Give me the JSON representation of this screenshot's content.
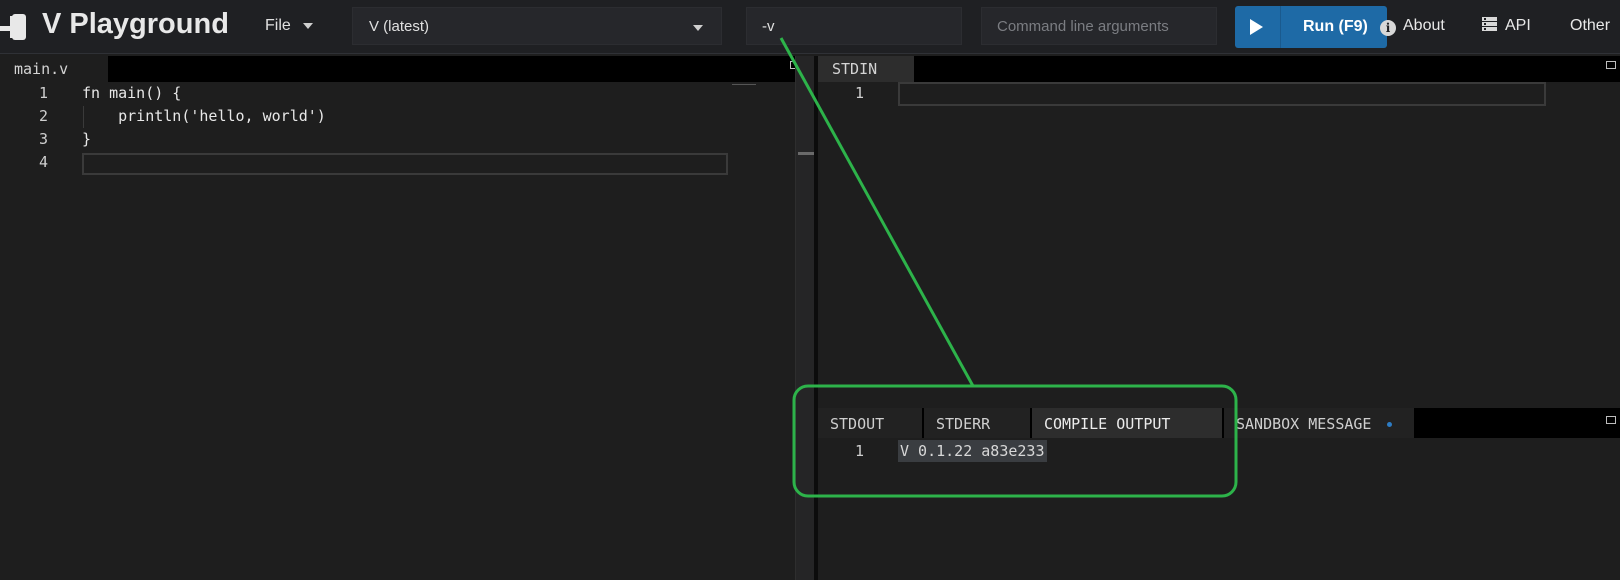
{
  "header": {
    "title": "V Playground",
    "file_menu": "File",
    "version": "V (latest)",
    "flags_value": "-v",
    "args_placeholder": "Command line arguments",
    "run_label": "Run (F9)",
    "about_label": "About",
    "api_label": "API",
    "other_label": "Other"
  },
  "editor": {
    "tab_label": "main.v",
    "lines": [
      {
        "num": "1",
        "code": "fn main() {"
      },
      {
        "num": "2",
        "code": "    println('hello, world')"
      },
      {
        "num": "3",
        "code": "}"
      },
      {
        "num": "4",
        "code": ""
      }
    ]
  },
  "stdin": {
    "tab_label": "STDIN",
    "line_num": "1"
  },
  "output": {
    "tabs": [
      {
        "label": "STDOUT"
      },
      {
        "label": "STDERR"
      },
      {
        "label": "COMPILE OUTPUT"
      },
      {
        "label": "SANDBOX MESSAGE"
      }
    ],
    "active_tab": "COMPILE OUTPUT",
    "line_num": "1",
    "text": "V 0.1.22 a83e233"
  },
  "colors": {
    "accent": "#1e6aa6",
    "annotation": "#2db34a",
    "background": "#1e1e1e"
  },
  "icons": [
    "gavel-icon",
    "play-icon",
    "info-icon",
    "api-icon",
    "chevron-down-icon"
  ]
}
